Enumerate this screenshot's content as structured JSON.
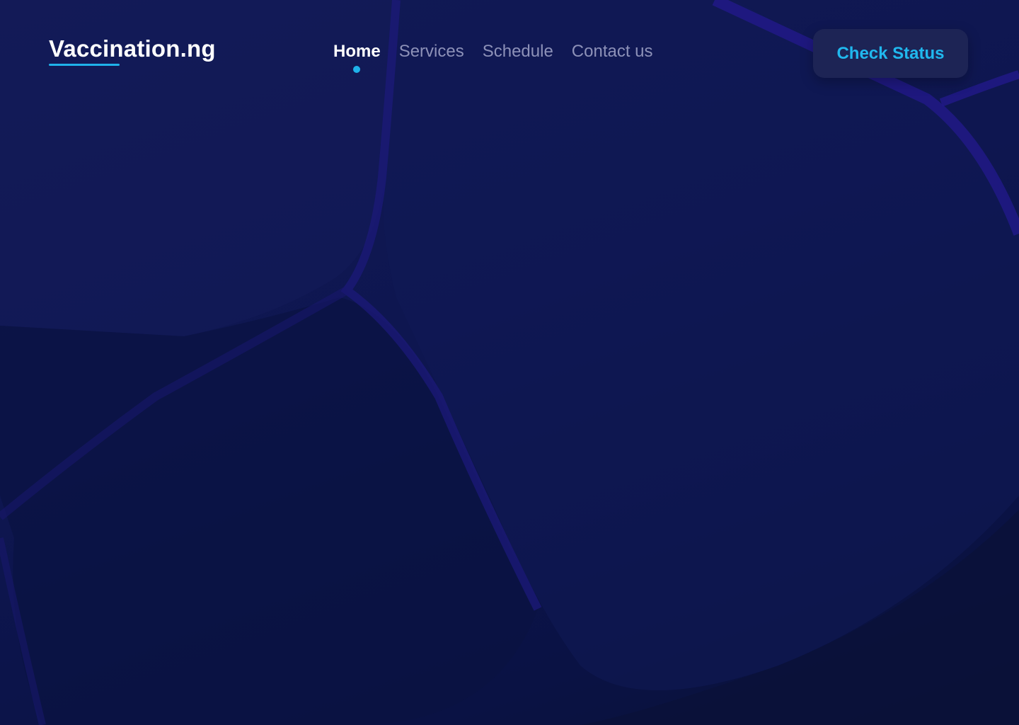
{
  "brand": {
    "name": "Vaccination.ng"
  },
  "nav": {
    "items": [
      {
        "label": "Home"
      },
      {
        "label": "Services"
      },
      {
        "label": "Schedule"
      },
      {
        "label": "Contact us"
      }
    ],
    "active": "Home"
  },
  "cta": {
    "label": "Check Status"
  },
  "colors": {
    "background": "#0e1650",
    "accent": "#1fb2ea",
    "nav_inactive": "#8d91b8",
    "button_bg": "#1d2455"
  }
}
